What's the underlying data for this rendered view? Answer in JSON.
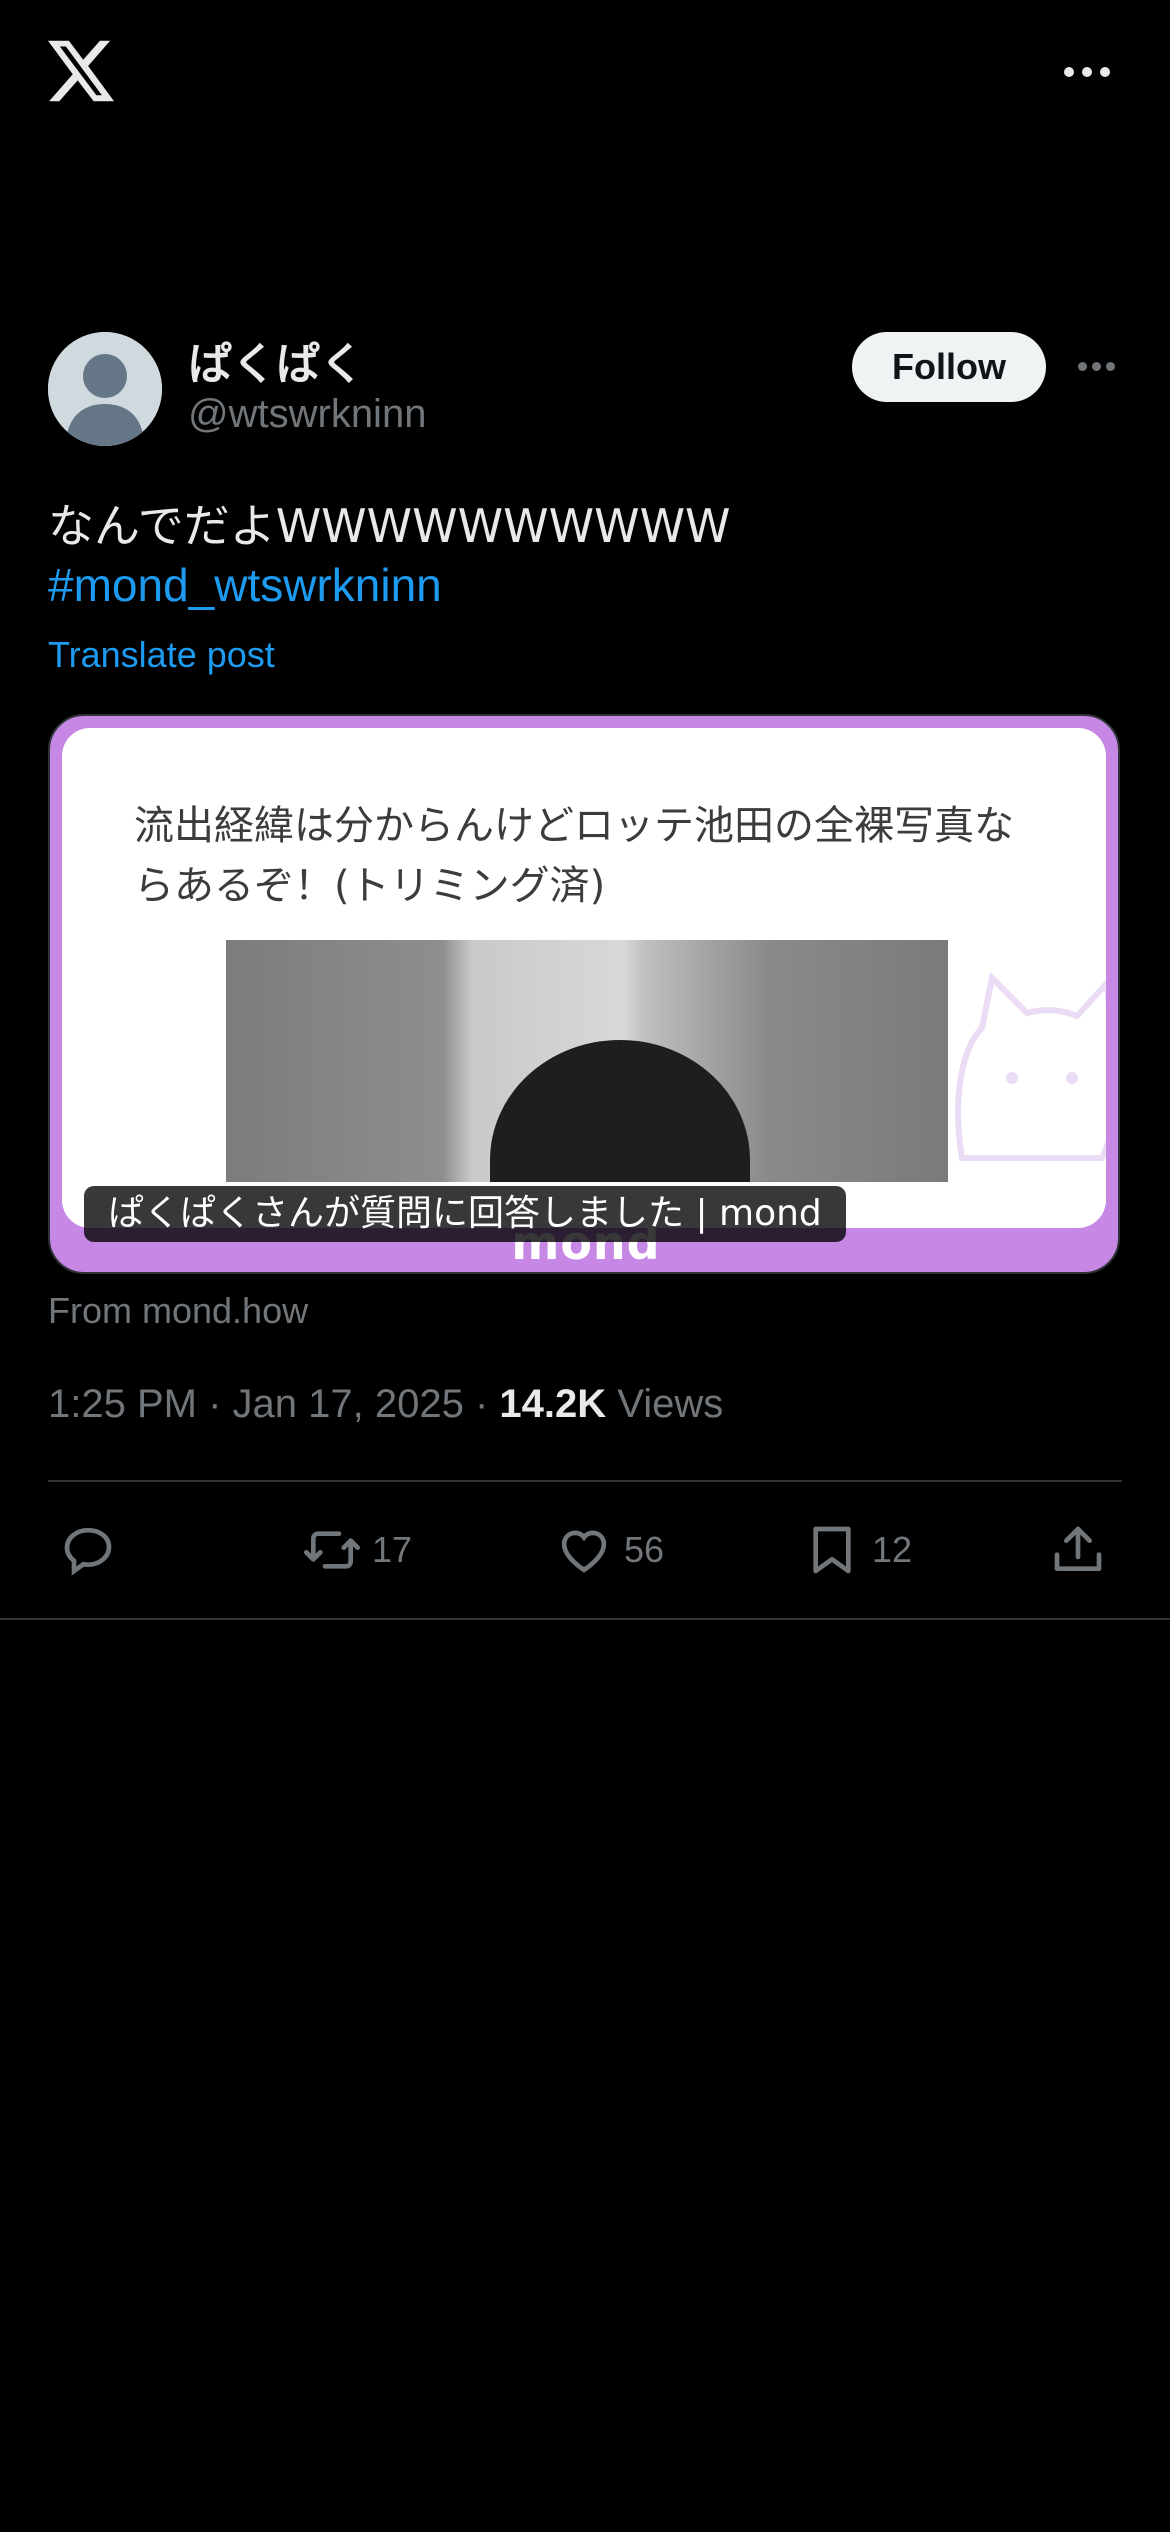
{
  "header": {
    "logo": "x-logo-icon",
    "more": "more-icon"
  },
  "post": {
    "display_name": "ぱくぱく",
    "handle": "@wtswrkninn",
    "follow_label": "Follow",
    "text": "なんでだよWWWWWWWWWW",
    "hashtag": "#mond_wtswrkninn",
    "translate_label": "Translate post"
  },
  "card": {
    "question": "流出経緯は分からんけどロッテ池田の全裸写真ならあるぞ！(トリミング済)",
    "brand": "mond",
    "caption": "ぱくぱくさんが質問に回答しました | mond",
    "source": "From mond.how"
  },
  "meta": {
    "time": "1:25 PM",
    "date": "Jan 17, 2025",
    "views_count": "14.2K",
    "views_label": "Views"
  },
  "actions": {
    "reply": {
      "icon": "reply-icon",
      "count": ""
    },
    "repost": {
      "icon": "repost-icon",
      "count": "17"
    },
    "like": {
      "icon": "heart-icon",
      "count": "56"
    },
    "bookmark": {
      "icon": "bookmark-icon",
      "count": "12"
    },
    "share": {
      "icon": "share-icon"
    }
  },
  "colors": {
    "accent": "#1d9bf0",
    "card_frame": "#c688e4",
    "muted": "#71767b",
    "background": "#000000"
  }
}
